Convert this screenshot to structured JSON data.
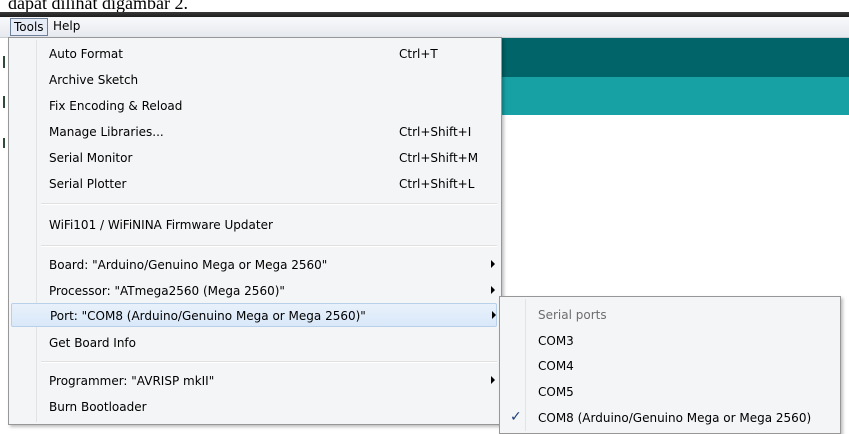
{
  "doc_fragment": "dapat dilihat digambar 2.",
  "menubar": {
    "tools_label": "Tools",
    "help_label": "Help"
  },
  "tools_menu": {
    "auto_format": {
      "label": "Auto Format",
      "shortcut": "Ctrl+T"
    },
    "archive_sketch": {
      "label": "Archive Sketch"
    },
    "fix_encoding": {
      "label": "Fix Encoding & Reload"
    },
    "manage_libraries": {
      "label": "Manage Libraries...",
      "shortcut": "Ctrl+Shift+I"
    },
    "serial_monitor": {
      "label": "Serial Monitor",
      "shortcut": "Ctrl+Shift+M"
    },
    "serial_plotter": {
      "label": "Serial Plotter",
      "shortcut": "Ctrl+Shift+L"
    },
    "firmware_updater": {
      "label": "WiFi101 / WiFiNINA Firmware Updater"
    },
    "board": {
      "label": "Board: \"Arduino/Genuino Mega or Mega 2560\""
    },
    "processor": {
      "label": "Processor: \"ATmega2560 (Mega 2560)\""
    },
    "port": {
      "label": "Port: \"COM8 (Arduino/Genuino Mega or Mega 2560)\""
    },
    "board_info": {
      "label": "Get Board Info"
    },
    "programmer": {
      "label": "Programmer: \"AVRISP mkII\""
    },
    "burn_bootloader": {
      "label": "Burn Bootloader"
    }
  },
  "port_submenu": {
    "header": "Serial ports",
    "ports": [
      "COM3",
      "COM4",
      "COM5",
      "COM8 (Arduino/Genuino Mega or Mega 2560)"
    ],
    "selected": "COM8 (Arduino/Genuino Mega or Mega 2560)",
    "check_icon": "check-icon"
  },
  "colors": {
    "toolbar": "#006468",
    "tabs": "#17a1a5",
    "highlight": "#d9e8f9"
  }
}
